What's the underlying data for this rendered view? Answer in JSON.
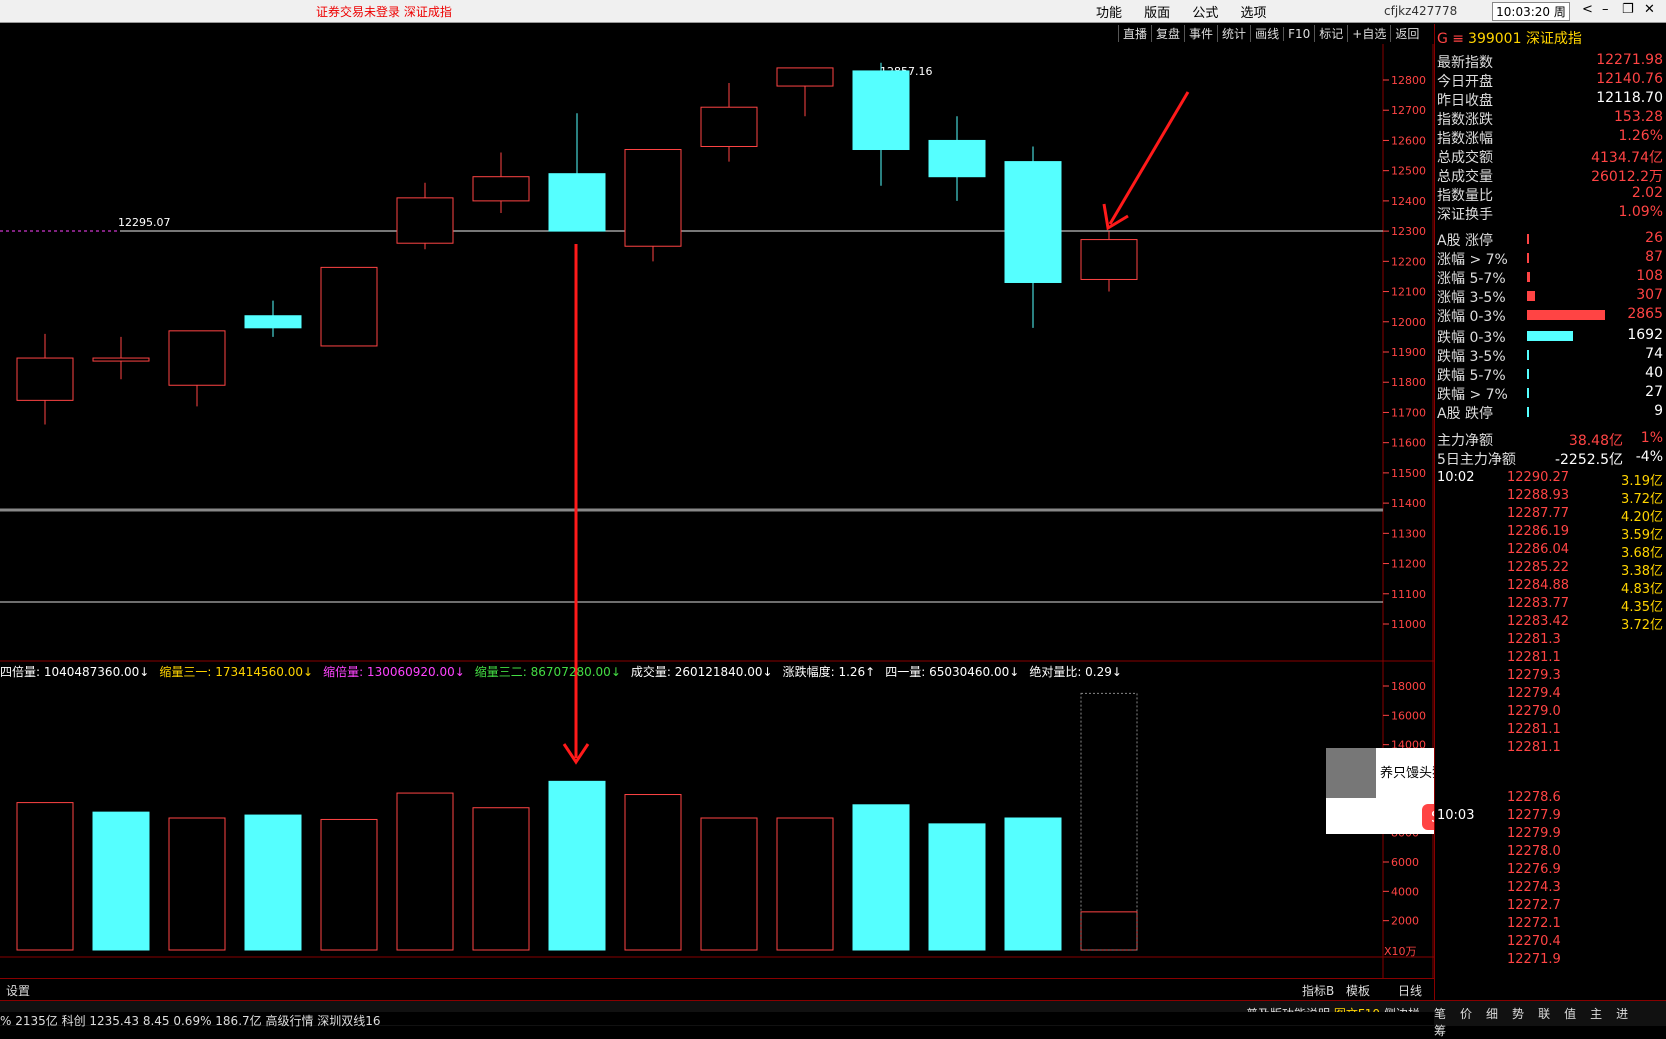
{
  "topbar": {
    "warning": "证券交易未登录  深证成指",
    "menu": [
      "功能",
      "版面",
      "公式",
      "选项"
    ],
    "user": "cfjkz427778",
    "clock": "10:03:20 周五"
  },
  "toolbar": [
    "直播",
    "复盘",
    "事件",
    "统计",
    "画线",
    "F10",
    "标记",
    "+自选",
    "返回"
  ],
  "chart": {
    "high_label": "12857.16",
    "ref_label": "12295.07"
  },
  "chart_data": {
    "type": "candlestick",
    "price_axis": [
      "12800",
      "12700",
      "12600",
      "12500",
      "12400",
      "12300",
      "12200",
      "12100",
      "12000",
      "11900",
      "11800",
      "11700",
      "11600",
      "11500",
      "11400",
      "11300",
      "11200",
      "11100",
      "11000"
    ],
    "volume_axis": [
      "18000",
      "16000",
      "14000",
      "12000",
      "10000",
      "8000",
      "6000",
      "4000",
      "2000"
    ],
    "volume_unit": "X10万",
    "candles": [
      {
        "open": 11740,
        "close": 11880,
        "high": 11960,
        "low": 11660,
        "dir": "up"
      },
      {
        "open": 11880,
        "close": 11870,
        "high": 11950,
        "low": 11810,
        "dir": "doji"
      },
      {
        "open": 11790,
        "close": 11970,
        "high": 11970,
        "low": 11720,
        "dir": "up"
      },
      {
        "open": 11980,
        "close": 12020,
        "high": 12070,
        "low": 11950,
        "dir": "down"
      },
      {
        "open": 11920,
        "close": 12180,
        "high": 12180,
        "low": 11920,
        "dir": "up"
      },
      {
        "open": 12260,
        "close": 12410,
        "high": 12460,
        "low": 12240,
        "dir": "up"
      },
      {
        "open": 12400,
        "close": 12480,
        "high": 12560,
        "low": 12360,
        "dir": "up"
      },
      {
        "open": 12490,
        "close": 12300,
        "high": 12690,
        "low": 12300,
        "dir": "down"
      },
      {
        "open": 12250,
        "close": 12570,
        "high": 12570,
        "low": 12200,
        "dir": "up"
      },
      {
        "open": 12580,
        "close": 12710,
        "high": 12790,
        "low": 12530,
        "dir": "up"
      },
      {
        "open": 12780,
        "close": 12840,
        "high": 12840,
        "low": 12680,
        "dir": "up"
      },
      {
        "open": 12830,
        "close": 12570,
        "high": 12857,
        "low": 12450,
        "dir": "down"
      },
      {
        "open": 12600,
        "close": 12480,
        "high": 12680,
        "low": 12400,
        "dir": "down"
      },
      {
        "open": 12530,
        "close": 12130,
        "high": 12580,
        "low": 11980,
        "dir": "down"
      },
      {
        "open": 12140,
        "close": 12272,
        "high": 12300,
        "low": 12100,
        "dir": "up"
      }
    ],
    "volumes": [
      {
        "v": 10050,
        "dir": "up"
      },
      {
        "v": 9400,
        "dir": "down"
      },
      {
        "v": 9000,
        "dir": "up"
      },
      {
        "v": 9200,
        "dir": "down"
      },
      {
        "v": 8900,
        "dir": "up"
      },
      {
        "v": 10700,
        "dir": "up"
      },
      {
        "v": 9700,
        "dir": "up"
      },
      {
        "v": 11500,
        "dir": "down"
      },
      {
        "v": 10600,
        "dir": "up"
      },
      {
        "v": 9000,
        "dir": "up"
      },
      {
        "v": 9000,
        "dir": "up"
      },
      {
        "v": 9900,
        "dir": "down"
      },
      {
        "v": 8600,
        "dir": "down"
      },
      {
        "v": 9000,
        "dir": "down"
      },
      {
        "v": 2600,
        "dir": "up"
      }
    ],
    "volume_header": [
      {
        "label": "四倍量: 1040487360.00↓",
        "color": "#ffffff"
      },
      {
        "label": "缩量三一: 173414560.00↓",
        "color": "#ffd400"
      },
      {
        "label": "缩倍量: 130060920.00↓",
        "color": "#ff44ff"
      },
      {
        "label": "缩量三二: 86707280.00↓",
        "color": "#44dd44"
      },
      {
        "label": "成交量: 260121840.00↓",
        "color": "#ffffff"
      },
      {
        "label": "涨跌幅度: 1.26↑",
        "color": "#ffffff"
      },
      {
        "label": "四一量: 65030460.00↓",
        "color": "#ffffff"
      },
      {
        "label": "绝对量比: 0.29↓",
        "color": "#ffffff"
      }
    ]
  },
  "right_panel": {
    "code": "399001",
    "name": "深证成指",
    "stats": [
      {
        "label": "最新指数",
        "value": "12271.98"
      },
      {
        "label": "今日开盘",
        "value": "12140.76"
      },
      {
        "label": "昨日收盘",
        "value": "12118.70"
      },
      {
        "label": "指数涨跌",
        "value": "153.28"
      },
      {
        "label": "指数涨幅",
        "value": "1.26%"
      },
      {
        "label": "总成交额",
        "value": "4134.74亿"
      },
      {
        "label": "总成交量",
        "value": "26012.2万"
      },
      {
        "label": "指数量比",
        "value": "2.02"
      },
      {
        "label": "深证换手",
        "value": "1.09%"
      }
    ],
    "breadth": [
      {
        "label": "A股 涨停",
        "value": "26",
        "frac": 0.01,
        "color": "#ff4444"
      },
      {
        "label": "涨幅 > 7%",
        "value": "87",
        "frac": 0.03,
        "color": "#ff4444"
      },
      {
        "label": "涨幅 5-7%",
        "value": "108",
        "frac": 0.04,
        "color": "#ff4444"
      },
      {
        "label": "涨幅 3-5%",
        "value": "307",
        "frac": 0.1,
        "color": "#ff4444"
      },
      {
        "label": "涨幅 0-3%",
        "value": "2865",
        "frac": 0.95,
        "color": "#ff4444"
      },
      {
        "label": "跌幅 0-3%",
        "value": "1692",
        "frac": 0.56,
        "color": "#55ffff"
      },
      {
        "label": "跌幅 3-5%",
        "value": "74",
        "frac": 0.02,
        "color": "#55ffff"
      },
      {
        "label": "跌幅 5-7%",
        "value": "40",
        "frac": 0.01,
        "color": "#55ffff"
      },
      {
        "label": "跌幅 > 7%",
        "value": "27",
        "frac": 0.01,
        "color": "#55ffff"
      },
      {
        "label": "A股 跌停",
        "value": "9",
        "frac": 0.005,
        "color": "#55ffff"
      }
    ],
    "flow": [
      {
        "label": "主力净额",
        "value": "38.48亿",
        "pct": "1%"
      },
      {
        "label": "5日主力净额",
        "value": "-2252.5亿",
        "pct": "-4%"
      }
    ],
    "ticks": [
      {
        "time": "10:02",
        "price": "12290.27",
        "amt": "3.19亿"
      },
      {
        "time": "",
        "price": "12288.93",
        "amt": "3.72亿"
      },
      {
        "time": "",
        "price": "12287.77",
        "amt": "4.20亿"
      },
      {
        "time": "",
        "price": "12286.19",
        "amt": "3.59亿"
      },
      {
        "time": "",
        "price": "12286.04",
        "amt": "3.68亿"
      },
      {
        "time": "",
        "price": "12285.22",
        "amt": "3.38亿"
      },
      {
        "time": "",
        "price": "12284.88",
        "amt": "4.83亿"
      },
      {
        "time": "",
        "price": "12283.77",
        "amt": "4.35亿"
      },
      {
        "time": "",
        "price": "12283.42",
        "amt": "3.72亿"
      },
      {
        "time": "",
        "price": "12281.3",
        "amt": ""
      },
      {
        "time": "",
        "price": "12281.1",
        "amt": ""
      },
      {
        "time": "",
        "price": "12279.3",
        "amt": ""
      },
      {
        "time": "",
        "price": "12279.4",
        "amt": ""
      },
      {
        "time": "",
        "price": "12279.0",
        "amt": ""
      },
      {
        "time": "",
        "price": "12281.1",
        "amt": ""
      },
      {
        "time": "",
        "price": "12281.1",
        "amt": ""
      }
    ],
    "ticks2": [
      {
        "time": "",
        "price": "12278.6",
        "amt": ""
      },
      {
        "time": "10:03",
        "price": "12277.9",
        "amt": ""
      },
      {
        "time": "",
        "price": "12279.9",
        "amt": ""
      },
      {
        "time": "",
        "price": "12278.0",
        "amt": ""
      },
      {
        "time": "",
        "price": "12276.9",
        "amt": ""
      },
      {
        "time": "",
        "price": "12274.3",
        "amt": ""
      },
      {
        "time": "",
        "price": "12272.7",
        "amt": ""
      },
      {
        "time": "",
        "price": "12272.1",
        "amt": ""
      },
      {
        "time": "",
        "price": "12270.4",
        "amt": ""
      },
      {
        "time": "",
        "price": "12271.9",
        "amt": ""
      }
    ]
  },
  "ime": {
    "message": "养只馒头猫：打字赚米盖房子",
    "button": "换肤",
    "lang": "中"
  },
  "bottom": {
    "settings": "设置",
    "indicator": "指标B",
    "template": "模板",
    "period": "日线",
    "help": "普及版功能说明",
    "f10": "图文F10",
    "sidebar": "侧边栏",
    "tabs": [
      "笔",
      "价",
      "细",
      "势",
      "联",
      "值",
      "主",
      "进",
      "筹"
    ],
    "status": "%   2135亿   科创 1235.43   8.45   0.69%   186.7亿      高级行情  深圳双线16"
  }
}
